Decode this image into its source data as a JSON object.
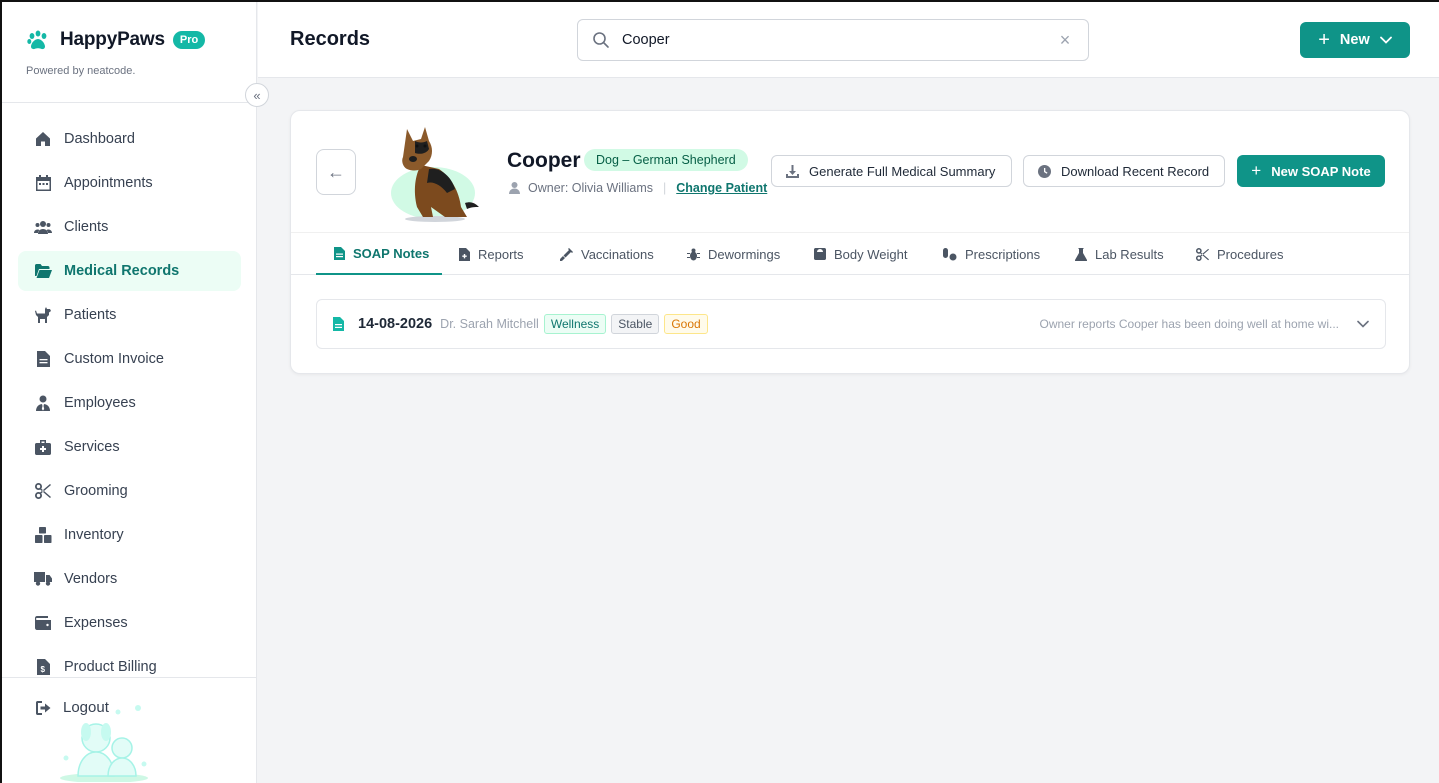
{
  "brand": {
    "name": "HappyPaws",
    "badge": "Pro",
    "powered_by": "Powered by neatcode."
  },
  "sidebar": {
    "collapse_icon": "double-chevron-left-icon",
    "items": [
      {
        "label": "Dashboard",
        "icon": "home-icon",
        "active": false
      },
      {
        "label": "Appointments",
        "icon": "calendar-icon",
        "active": false
      },
      {
        "label": "Clients",
        "icon": "users-icon",
        "active": false
      },
      {
        "label": "Medical Records",
        "icon": "folder-open-icon",
        "active": true
      },
      {
        "label": "Patients",
        "icon": "dog-icon",
        "active": false
      },
      {
        "label": "Custom Invoice",
        "icon": "invoice-icon",
        "active": false
      },
      {
        "label": "Employees",
        "icon": "user-tie-icon",
        "active": false
      },
      {
        "label": "Services",
        "icon": "briefcase-medical-icon",
        "active": false
      },
      {
        "label": "Grooming",
        "icon": "scissors-icon",
        "active": false
      },
      {
        "label": "Inventory",
        "icon": "boxes-icon",
        "active": false
      },
      {
        "label": "Vendors",
        "icon": "truck-icon",
        "active": false
      },
      {
        "label": "Expenses",
        "icon": "wallet-icon",
        "active": false
      },
      {
        "label": "Product Billing",
        "icon": "receipt-icon",
        "active": false
      }
    ],
    "logout_label": "Logout"
  },
  "topbar": {
    "title": "Records",
    "search_value": "Cooper",
    "new_label": "New"
  },
  "patient": {
    "name": "Cooper",
    "breed": "Dog – German Shepherd",
    "owner": "Owner: Olivia Williams",
    "change_label": "Change Patient",
    "actions": {
      "summary": "Generate Full Medical Summary",
      "download": "Download Recent Record",
      "new_soap": "New SOAP Note"
    }
  },
  "tabs": [
    {
      "label": "SOAP Notes",
      "icon": "file-icon",
      "active": true
    },
    {
      "label": "Reports",
      "icon": "file-medical-icon",
      "active": false
    },
    {
      "label": "Vaccinations",
      "icon": "syringe-icon",
      "active": false
    },
    {
      "label": "Dewormings",
      "icon": "bug-icon",
      "active": false
    },
    {
      "label": "Body Weight",
      "icon": "weight-icon",
      "active": false
    },
    {
      "label": "Prescriptions",
      "icon": "pills-icon",
      "active": false
    },
    {
      "label": "Lab Results",
      "icon": "flask-icon",
      "active": false
    },
    {
      "label": "Procedures",
      "icon": "scissors-icon",
      "active": false
    }
  ],
  "records": [
    {
      "date": "14-08-2026",
      "doctor": "Dr. Sarah Mitchell",
      "tags": [
        "Wellness",
        "Stable",
        "Good"
      ],
      "summary": "Owner reports Cooper has been doing well at home wi..."
    }
  ],
  "colors": {
    "accent": "#0f9488",
    "active_bg": "#ecfdf5"
  }
}
